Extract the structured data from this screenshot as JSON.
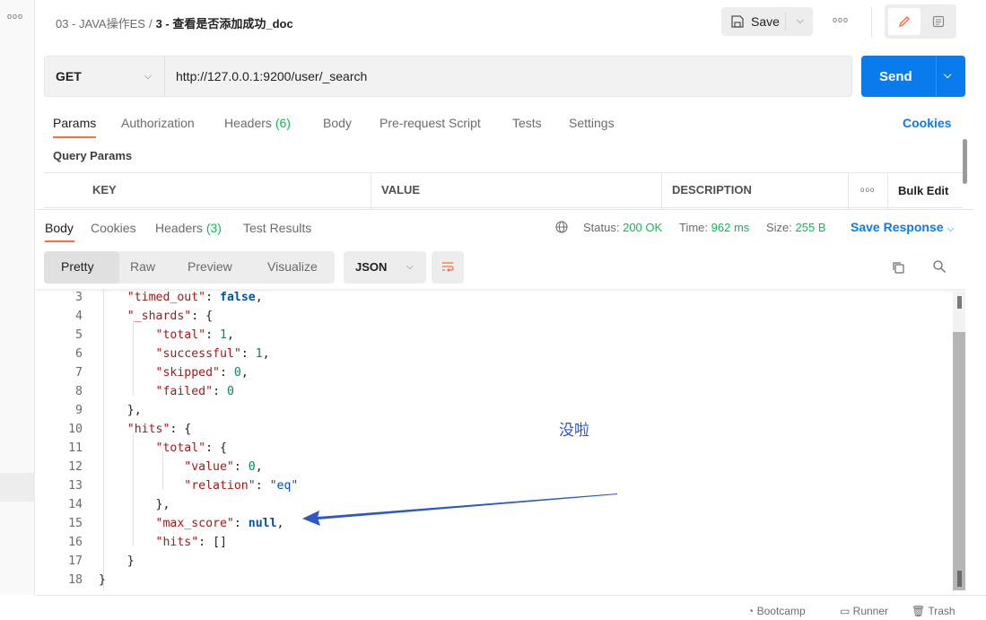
{
  "sidebar": {
    "more_icon": "more-dots-icon"
  },
  "titlebar": {
    "collection": "03 - JAVA操作ES",
    "separator": "/",
    "request_name": "3 - 查看是否添加成功_doc",
    "save_label": "Save"
  },
  "request": {
    "method": "GET",
    "url": "http://127.0.0.1:9200/user/_search",
    "send_label": "Send",
    "tabs": [
      {
        "label": "Params",
        "count": ""
      },
      {
        "label": "Authorization",
        "count": ""
      },
      {
        "label": "Headers",
        "count": "(6)"
      },
      {
        "label": "Body",
        "count": ""
      },
      {
        "label": "Pre-request Script",
        "count": ""
      },
      {
        "label": "Tests",
        "count": ""
      },
      {
        "label": "Settings",
        "count": ""
      }
    ],
    "cookies_label": "Cookies"
  },
  "query_params": {
    "title": "Query Params",
    "columns": [
      "KEY",
      "VALUE",
      "DESCRIPTION"
    ],
    "bulk_edit": "Bulk Edit"
  },
  "response": {
    "tabs": [
      {
        "label": "Body",
        "count": ""
      },
      {
        "label": "Cookies",
        "count": ""
      },
      {
        "label": "Headers",
        "count": "(3)"
      },
      {
        "label": "Test Results",
        "count": ""
      }
    ],
    "status_label": "Status:",
    "status_value": "200 OK",
    "time_label": "Time:",
    "time_value": "962 ms",
    "size_label": "Size:",
    "size_value": "255 B",
    "save_response": "Save Response",
    "view_modes": [
      "Pretty",
      "Raw",
      "Preview",
      "Visualize"
    ],
    "format": "JSON"
  },
  "code_lines": [
    {
      "ln": "3"
    },
    {
      "ln": "4"
    },
    {
      "ln": "5"
    },
    {
      "ln": "6"
    },
    {
      "ln": "7"
    },
    {
      "ln": "8"
    },
    {
      "ln": "9"
    },
    {
      "ln": "10"
    },
    {
      "ln": "11"
    },
    {
      "ln": "12"
    },
    {
      "ln": "13"
    },
    {
      "ln": "14"
    },
    {
      "ln": "15"
    },
    {
      "ln": "16"
    },
    {
      "ln": "17"
    },
    {
      "ln": "18"
    }
  ],
  "code": {
    "k_timed_out": "\"timed_out\"",
    "v_timed_out": "false",
    "k_shards": "\"_shards\"",
    "k_total": "\"total\"",
    "v_total": "1",
    "k_successful": "\"successful\"",
    "v_successful": "1",
    "k_skipped": "\"skipped\"",
    "v_skipped": "0",
    "k_failed": "\"failed\"",
    "v_failed": "0",
    "k_hits": "\"hits\"",
    "k_total2": "\"total\"",
    "k_value": "\"value\"",
    "v_value": "0",
    "k_relation": "\"relation\"",
    "v_relation": "\"eq\"",
    "k_max_score": "\"max_score\"",
    "v_max_score": "null",
    "k_hits2": "\"hits\"",
    "v_hits2": "[]"
  },
  "annotation": {
    "text": "没啦",
    "color": "#2e56c8"
  },
  "footer": {
    "items": [
      "Bootcamp",
      "Runner",
      "Trash"
    ]
  },
  "colors": {
    "accent": "#ff6c37",
    "primary": "#097bed",
    "success": "#0cbb52"
  }
}
